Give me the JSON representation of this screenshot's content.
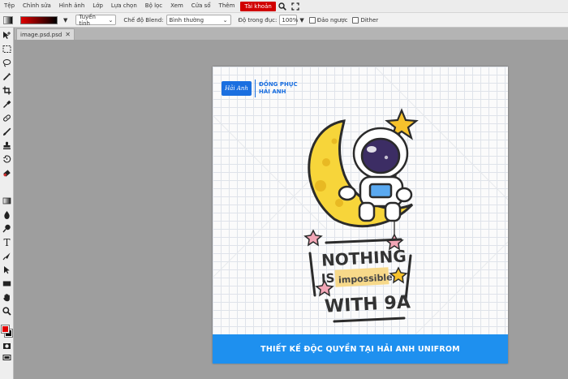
{
  "menu": {
    "items": [
      "Tệp",
      "Chỉnh sửa",
      "Hình ảnh",
      "Lớp",
      "Lựa chọn",
      "Bộ lọc",
      "Xem",
      "Cửa sổ",
      "Thêm"
    ],
    "account": "Tài khoản",
    "search_icon": "search-icon",
    "fullscreen_icon": "fullscreen-icon"
  },
  "options": {
    "gradient_type": "Tuyến tính",
    "blend_label": "Chế độ Blend:",
    "blend_value": "Bình thường",
    "opacity_label": "Độ trong đục:",
    "opacity_value": "100%",
    "reverse_label": "Đảo ngược",
    "dither_label": "Dither"
  },
  "colors": {
    "foreground": "#e00000",
    "background": "#000000",
    "accent": "#d10000",
    "brand_blue": "#1e90ef"
  },
  "document": {
    "tab_name": "image.psd.psd"
  },
  "artwork": {
    "brand_line1": "ĐỒNG PHỤC",
    "brand_line2": "HẢI ANH",
    "logo_text": "Hải Anh",
    "headline_1": "NOTHING",
    "headline_is": "IS",
    "headline_impossible": "impossible",
    "headline_with": "WITH 9A",
    "footer": "THIẾT KẾ ĐỘC QUYỀN TẠI HẢI ANH UNIFROM"
  }
}
